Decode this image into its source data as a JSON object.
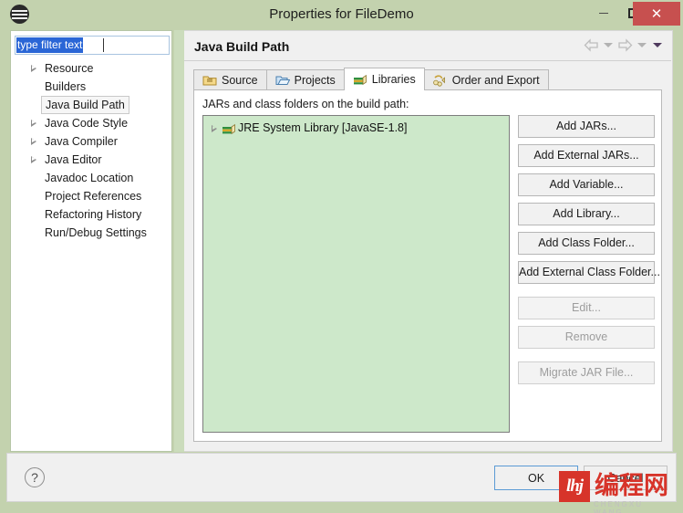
{
  "window": {
    "title": "Properties for FileDemo",
    "icon": "eclipse-icon",
    "controls": {
      "minimize": "–",
      "maximize": "□",
      "close": "✕"
    }
  },
  "sidebar": {
    "filter": {
      "value": "type filter text",
      "placeholder": "type filter text"
    },
    "items": [
      {
        "label": "Resource",
        "expandable": true,
        "selected": false
      },
      {
        "label": "Builders",
        "expandable": false,
        "selected": false
      },
      {
        "label": "Java Build Path",
        "expandable": false,
        "selected": true
      },
      {
        "label": "Java Code Style",
        "expandable": true,
        "selected": false
      },
      {
        "label": "Java Compiler",
        "expandable": true,
        "selected": false
      },
      {
        "label": "Java Editor",
        "expandable": true,
        "selected": false
      },
      {
        "label": "Javadoc Location",
        "expandable": false,
        "selected": false
      },
      {
        "label": "Project References",
        "expandable": false,
        "selected": false
      },
      {
        "label": "Refactoring History",
        "expandable": false,
        "selected": false
      },
      {
        "label": "Run/Debug Settings",
        "expandable": false,
        "selected": false
      }
    ]
  },
  "page": {
    "title": "Java Build Path",
    "nav": {
      "back": "back-arrow-icon",
      "back_menu": "chevron-down-icon",
      "forward": "forward-arrow-icon",
      "forward_menu": "chevron-down-icon",
      "view_menu": "chevron-down-icon"
    }
  },
  "tabs": [
    {
      "label": "Source",
      "icon": "source-folder-icon",
      "active": false
    },
    {
      "label": "Projects",
      "icon": "open-folder-icon",
      "active": false
    },
    {
      "label": "Libraries",
      "icon": "libraries-books-icon",
      "active": true
    },
    {
      "label": "Order and Export",
      "icon": "order-export-icon",
      "active": false
    }
  ],
  "libraries_panel": {
    "label": "JARs and class folders on the build path:",
    "entries": [
      {
        "label": "JRE System Library [JavaSE-1.8]",
        "icon": "library-books-icon",
        "expandable": true
      }
    ],
    "buttons": [
      {
        "label": "Add JARs...",
        "enabled": true
      },
      {
        "label": "Add External JARs...",
        "enabled": true
      },
      {
        "label": "Add Variable...",
        "enabled": true
      },
      {
        "label": "Add Library...",
        "enabled": true
      },
      {
        "label": "Add Class Folder...",
        "enabled": true
      },
      {
        "label": "Add External Class Folder...",
        "enabled": true
      },
      {
        "label": "Edit...",
        "enabled": false
      },
      {
        "label": "Remove",
        "enabled": false
      },
      {
        "label": "Migrate JAR File...",
        "enabled": false
      }
    ]
  },
  "footer": {
    "help": "?",
    "ok": "OK",
    "cancel": "Cancel"
  },
  "watermark": {
    "logo_text": "lhj",
    "text": "编程网",
    "sub": "CHENGXU WANG"
  },
  "colors": {
    "titlebar": "#c3d2ae",
    "close_button": "#c7504f",
    "tree_background": "#cde8ca",
    "selection_blue": "#2a66d6",
    "focus_border": "#5b9bd5",
    "watermark_red": "#d7342a"
  }
}
